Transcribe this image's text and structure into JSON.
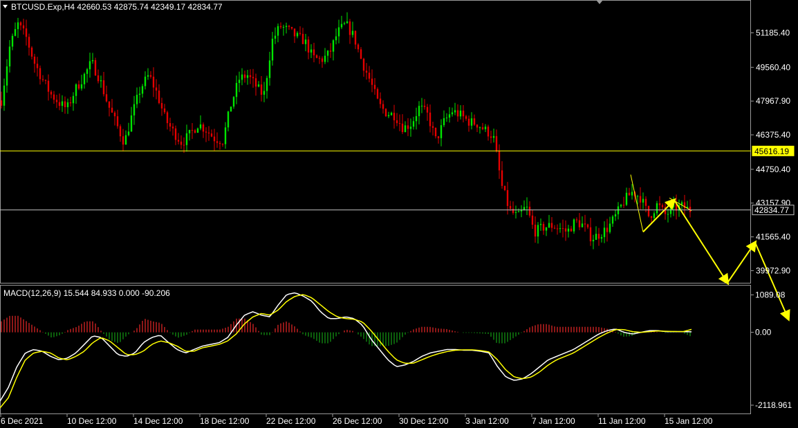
{
  "header": {
    "symbol_line": "BTCUSD.Exp,H4  42660.53 42875.74 42349.17 42834.77"
  },
  "price_panel": {
    "y_ticks": [
      "51185.40",
      "49560.40",
      "47967.90",
      "46375.40",
      "44750.40",
      "43157.90",
      "41565.40",
      "39972.90"
    ],
    "y_tick_values": [
      51185.4,
      49560.4,
      47967.9,
      46375.4,
      44750.4,
      43157.9,
      41565.4,
      39972.9
    ],
    "ylim": [
      39400,
      52700
    ],
    "levels": [
      {
        "label": "45616.19",
        "value": 45616.19,
        "color": "#ffff00",
        "box_bg": "#ffff00",
        "box_fg": "#000000"
      },
      {
        "label": "42834.77",
        "value": 42834.77,
        "color": "#c0c0c0",
        "box_bg": "#000000",
        "box_fg": "#ffffff"
      }
    ],
    "candle_colors": {
      "bull": "#00e600",
      "bear": "#e60000"
    },
    "arrow_color": "#ffff00"
  },
  "macd_panel": {
    "label": "MACD(12,26,9) 15.544 84.933 0.000 -90.206",
    "y_ticks": [
      "1089.08",
      "0.00",
      "-2118.961"
    ],
    "y_tick_values": [
      1089.08,
      0,
      -2118.961
    ],
    "ylim": [
      -2360,
      1360
    ],
    "colors": {
      "hist_pos": "#cc2222",
      "hist_neg": "#118811",
      "main": "#ffffff",
      "signal": "#ffff00"
    }
  },
  "x_axis": {
    "labels": [
      "6 Dec 2021",
      "10 Dec 12:00",
      "14 Dec 12:00",
      "18 Dec 12:00",
      "22 Dec 12:00",
      "26 Dec 12:00",
      "30 Dec 12:00",
      "3 Jan 12:00",
      "7 Jan 12:00",
      "11 Jan 12:00",
      "15 Jan 12:00"
    ]
  },
  "chart_data": {
    "type": "candlestick",
    "title": "BTCUSD.Exp,H4",
    "ohlc_last": {
      "open": 42660.53,
      "high": 42875.74,
      "low": 42349.17,
      "close": 42834.77
    },
    "x": [
      "6 Dec 2021",
      "10 Dec 12:00",
      "14 Dec 12:00",
      "18 Dec 12:00",
      "22 Dec 12:00",
      "26 Dec 12:00",
      "30 Dec 12:00",
      "3 Jan 12:00",
      "7 Jan 12:00",
      "11 Jan 12:00",
      "15 Jan 12:00"
    ],
    "close_path": [
      48000,
      50500,
      51600,
      51000,
      49800,
      49000,
      48300,
      47900,
      47600,
      48500,
      49100,
      49800,
      49000,
      47800,
      46900,
      46000,
      47400,
      48600,
      49200,
      48300,
      47100,
      46500,
      46000,
      46400,
      46900,
      46600,
      46200,
      46100,
      47800,
      49000,
      49200,
      48700,
      48200,
      50800,
      51500,
      51300,
      51000,
      50800,
      50000,
      49900,
      50200,
      51200,
      51600,
      51000,
      49800,
      48900,
      47800,
      47400,
      47300,
      46700,
      46900,
      47700,
      47300,
      46100,
      47000,
      47500,
      47300,
      47000,
      46900,
      46600,
      46300,
      44000,
      42800,
      42500,
      43000,
      41800,
      42000,
      42100,
      42000,
      41800,
      42300,
      42100,
      41500,
      41700,
      42000,
      42600,
      43300,
      43700,
      43400,
      42500,
      43100,
      42600,
      42900,
      43000,
      42834
    ],
    "macd_main_path": [
      -2000,
      -1600,
      -1000,
      -600,
      -500,
      -550,
      -700,
      -800,
      -750,
      -600,
      -350,
      -100,
      -150,
      -400,
      -650,
      -700,
      -600,
      -300,
      -150,
      -80,
      -300,
      -500,
      -600,
      -500,
      -400,
      -350,
      -300,
      -150,
      200,
      500,
      600,
      500,
      450,
      800,
      1100,
      1150,
      1050,
      900,
      600,
      400,
      400,
      450,
      400,
      200,
      -200,
      -500,
      -800,
      -1000,
      -950,
      -850,
      -700,
      -600,
      -550,
      -500,
      -500,
      -520,
      -520,
      -550,
      -600,
      -1000,
      -1300,
      -1400,
      -1350,
      -1200,
      -1000,
      -800,
      -700,
      -600,
      -500,
      -350,
      -200,
      -50,
      50,
      100,
      0,
      -50,
      0,
      50,
      50,
      20,
      20,
      20,
      15
    ],
    "macd_signal_path": [
      -2200,
      -1900,
      -1300,
      -800,
      -600,
      -550,
      -600,
      -750,
      -800,
      -700,
      -550,
      -300,
      -150,
      -250,
      -450,
      -650,
      -650,
      -550,
      -350,
      -250,
      -300,
      -400,
      -550,
      -550,
      -450,
      -400,
      -350,
      -250,
      -50,
      250,
      450,
      550,
      500,
      650,
      900,
      1050,
      1100,
      1000,
      800,
      600,
      450,
      400,
      380,
      300,
      50,
      -250,
      -550,
      -800,
      -900,
      -900,
      -800,
      -700,
      -620,
      -560,
      -520,
      -510,
      -510,
      -530,
      -570,
      -800,
      -1100,
      -1300,
      -1350,
      -1300,
      -1150,
      -950,
      -800,
      -700,
      -600,
      -450,
      -300,
      -150,
      -20,
      80,
      80,
      20,
      0,
      20,
      40,
      30,
      25,
      20,
      85
    ],
    "projection_arrow": [
      {
        "t": "11 Jan 12:00",
        "price": 41800
      },
      {
        "t": "12 Jan",
        "price": 43300
      },
      {
        "t": "16 Jan",
        "price": 39400
      },
      {
        "t": "17 Jan",
        "price": 41300
      },
      {
        "t": "18 Jan",
        "price": 37700
      }
    ]
  }
}
